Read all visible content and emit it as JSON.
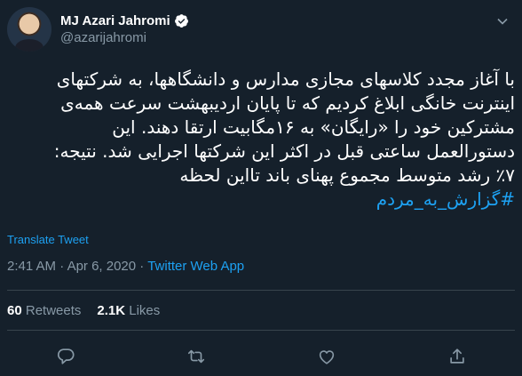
{
  "author": {
    "name": "MJ Azari Jahromi",
    "handle": "@azarijahromi"
  },
  "tweet": {
    "lines": [
      "با آغاز مجدد کلاسهای مجازی مدارس و دانشگاهها، به شرکتهای",
      "اینترنت خانگی ابلاغ کردیم که تا پایان اردیبهشت سرعت همه‌ی",
      "مشترکین خود را «رایگان» به ۱۶مگابیت ارتقا دهند. این",
      "دستورالعمل ساعتی قبل در اکثر این شرکتها اجرایی شد. نتیجه:",
      "٪۷ رشد متوسط مجموع پهنای باند تااین لحظه"
    ],
    "hashtag": "#گزارش_به_مردم"
  },
  "translate_label": "Translate Tweet",
  "meta": {
    "time": "2:41 AM",
    "separator1": " · ",
    "date": "Apr 6, 2020",
    "separator2": " · ",
    "app": "Twitter Web App"
  },
  "stats": {
    "retweets_count": "60",
    "retweets_label": "Retweets",
    "likes_count": "2.1K",
    "likes_label": "Likes"
  },
  "icons": {
    "verified": "verified-badge-icon",
    "caret": "chevron-down-icon",
    "reply": "reply-icon",
    "retweet": "retweet-icon",
    "like": "heart-icon",
    "share": "share-icon"
  },
  "colors": {
    "background": "#15202b",
    "accent": "#1da1f2",
    "secondary_text": "#8899a6",
    "divider": "#38444d"
  }
}
